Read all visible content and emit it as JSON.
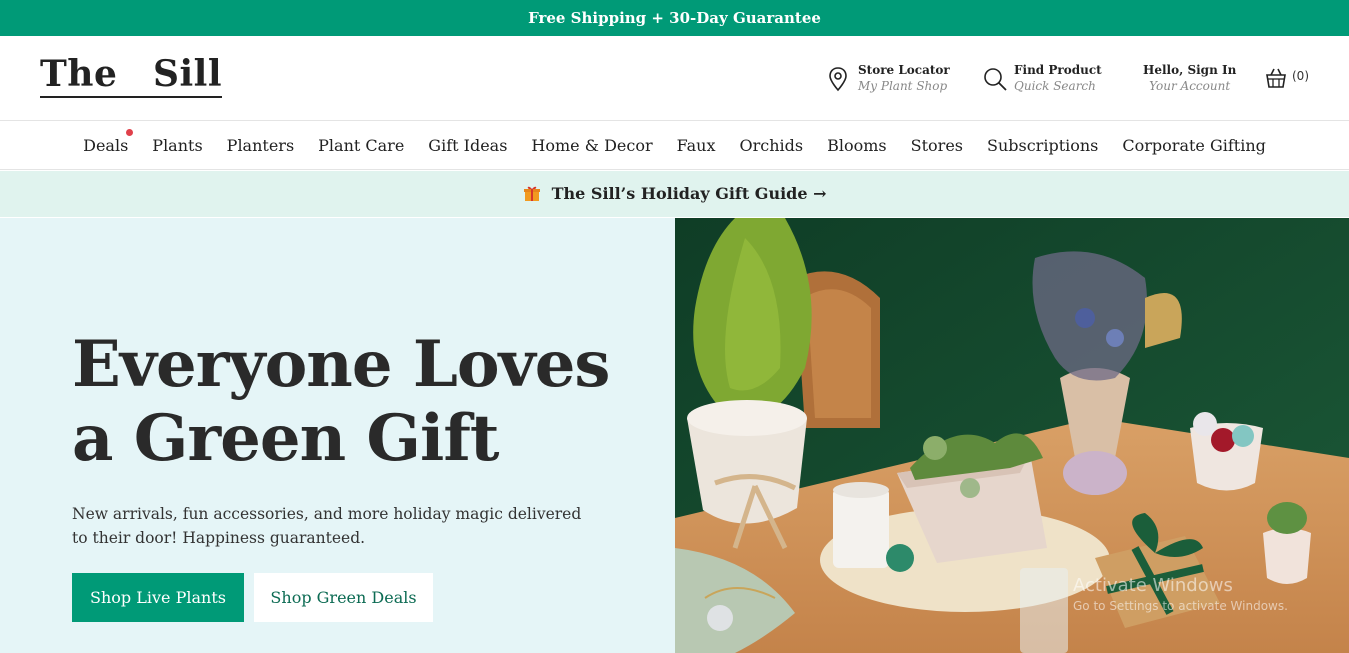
{
  "promo": {
    "text": "Free Shipping + 30-Day Guarantee"
  },
  "logo": {
    "word1": "The",
    "word2": "Sill"
  },
  "utilities": {
    "store": {
      "title": "Store Locator",
      "subtitle": "My Plant Shop",
      "icon": "map-pin-icon"
    },
    "find": {
      "title": "Find Product",
      "subtitle": "Quick Search",
      "icon": "search-icon"
    },
    "account": {
      "title": "Hello, Sign In",
      "subtitle": "Your Account"
    },
    "cart": {
      "count": "(0)",
      "icon": "basket-icon"
    }
  },
  "nav": {
    "items": [
      "Deals",
      "Plants",
      "Planters",
      "Plant Care",
      "Gift Ideas",
      "Home & Decor",
      "Faux",
      "Orchids",
      "Blooms",
      "Stores",
      "Subscriptions",
      "Corporate Gifting"
    ]
  },
  "gift_bar": {
    "text": "The Sill’s Holiday Gift Guide →",
    "icon": "gift-icon"
  },
  "hero": {
    "title": "Everyone Loves a Green Gift",
    "subtitle": "New arrivals, fun accessories, and more holiday magic delivered to their door! Happiness guaranteed.",
    "primary_cta": "Shop Live Plants",
    "secondary_cta": "Shop Green Deals"
  },
  "watermark": {
    "title": "Activate Windows",
    "subtitle": "Go to Settings to activate Windows."
  },
  "colors": {
    "brand_green": "#009a77",
    "nav_dot": "#e0404a",
    "hero_bg": "#e5f5f7",
    "gift_bar_bg": "#e0f3ee"
  }
}
